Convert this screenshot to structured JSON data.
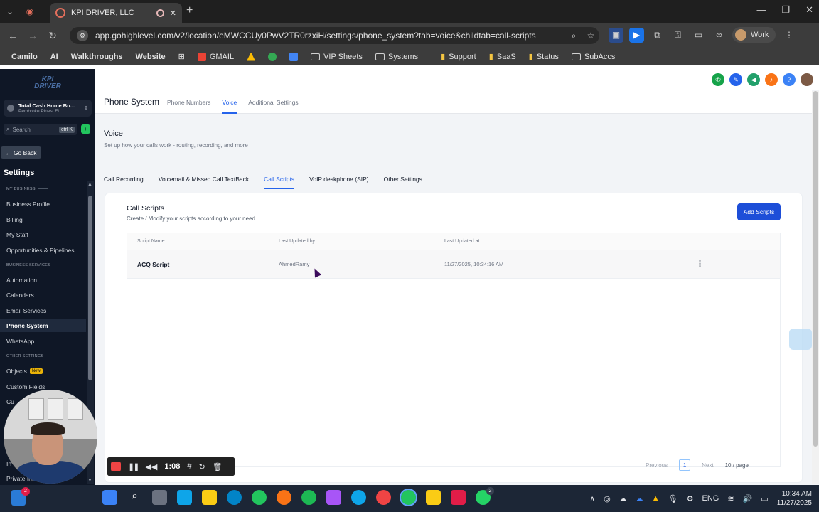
{
  "browser": {
    "tab_title": "KPI DRIVER, LLC",
    "url": "app.gohighlevel.com/v2/location/eMWCCUy0PwV2TR0rzxiH/settings/phone_system?tab=voice&childtab=call-scripts",
    "profile_label": "Work",
    "bookmarks": [
      "Camilo",
      "AI",
      "Walkthroughs",
      "Website",
      "GMAIL",
      "VIP Sheets",
      "Systems",
      "Support",
      "SaaS",
      "Status",
      "SubAccs"
    ]
  },
  "sidebar": {
    "logo_line1": "KPI",
    "logo_line2": "DRIVER",
    "account_name": "Total Cash Home Bu...",
    "account_location": "Pembroke Pines, FL",
    "search_placeholder": "Search",
    "search_shortcut": "ctrl K",
    "go_back": "Go Back",
    "title": "Settings",
    "section_my_business": "MY BUSINESS",
    "section_business_services": "BUSINESS SERVICES",
    "section_other_settings": "OTHER SETTINGS",
    "items": {
      "business_profile": "Business Profile",
      "billing": "Billing",
      "my_staff": "My Staff",
      "opportunities": "Opportunities & Pipelines",
      "automation": "Automation",
      "calendars": "Calendars",
      "email_services": "Email Services",
      "phone_system": "Phone System",
      "whatsapp": "WhatsApp",
      "objects": "Objects",
      "custom_fields": "Custom Fields",
      "cu": "Cu",
      "in": "In",
      "private_integrations": "Private Integ..."
    },
    "new_badge": "New"
  },
  "header": {
    "page_title": "Phone System",
    "tabs": [
      "Phone Numbers",
      "Voice",
      "Additional Settings"
    ]
  },
  "voice": {
    "title": "Voice",
    "subtitle": "Set up how your calls work - routing, recording, and more",
    "tabs": [
      "Call Recording",
      "Voicemail & Missed Call TextBack",
      "Call Scripts",
      "VoIP deskphone (SIP)",
      "Other Settings"
    ]
  },
  "call_scripts": {
    "title": "Call Scripts",
    "subtitle": "Create / Modify your scripts according to your need",
    "add_button": "Add Scripts",
    "columns": [
      "Script Name",
      "Last Updated by",
      "Last Updated at"
    ],
    "rows": [
      {
        "name": "ACQ Script",
        "updated_by": "AhmedRamy",
        "updated_at": "11/27/2025, 10:34:16 AM"
      }
    ],
    "pagination": {
      "previous": "Previous",
      "page": "1",
      "next": "Next",
      "page_size": "10 / page"
    }
  },
  "recorder": {
    "time": "1:08"
  },
  "taskbar": {
    "time": "10:34 AM",
    "date": "11/27/2025",
    "language": "ENG",
    "notification_count": "2",
    "whatsapp_count": "2"
  },
  "colors": {
    "accent": "#2563eb",
    "primary_button": "#1d4ed8",
    "sidebar_bg": "#0f1726"
  }
}
